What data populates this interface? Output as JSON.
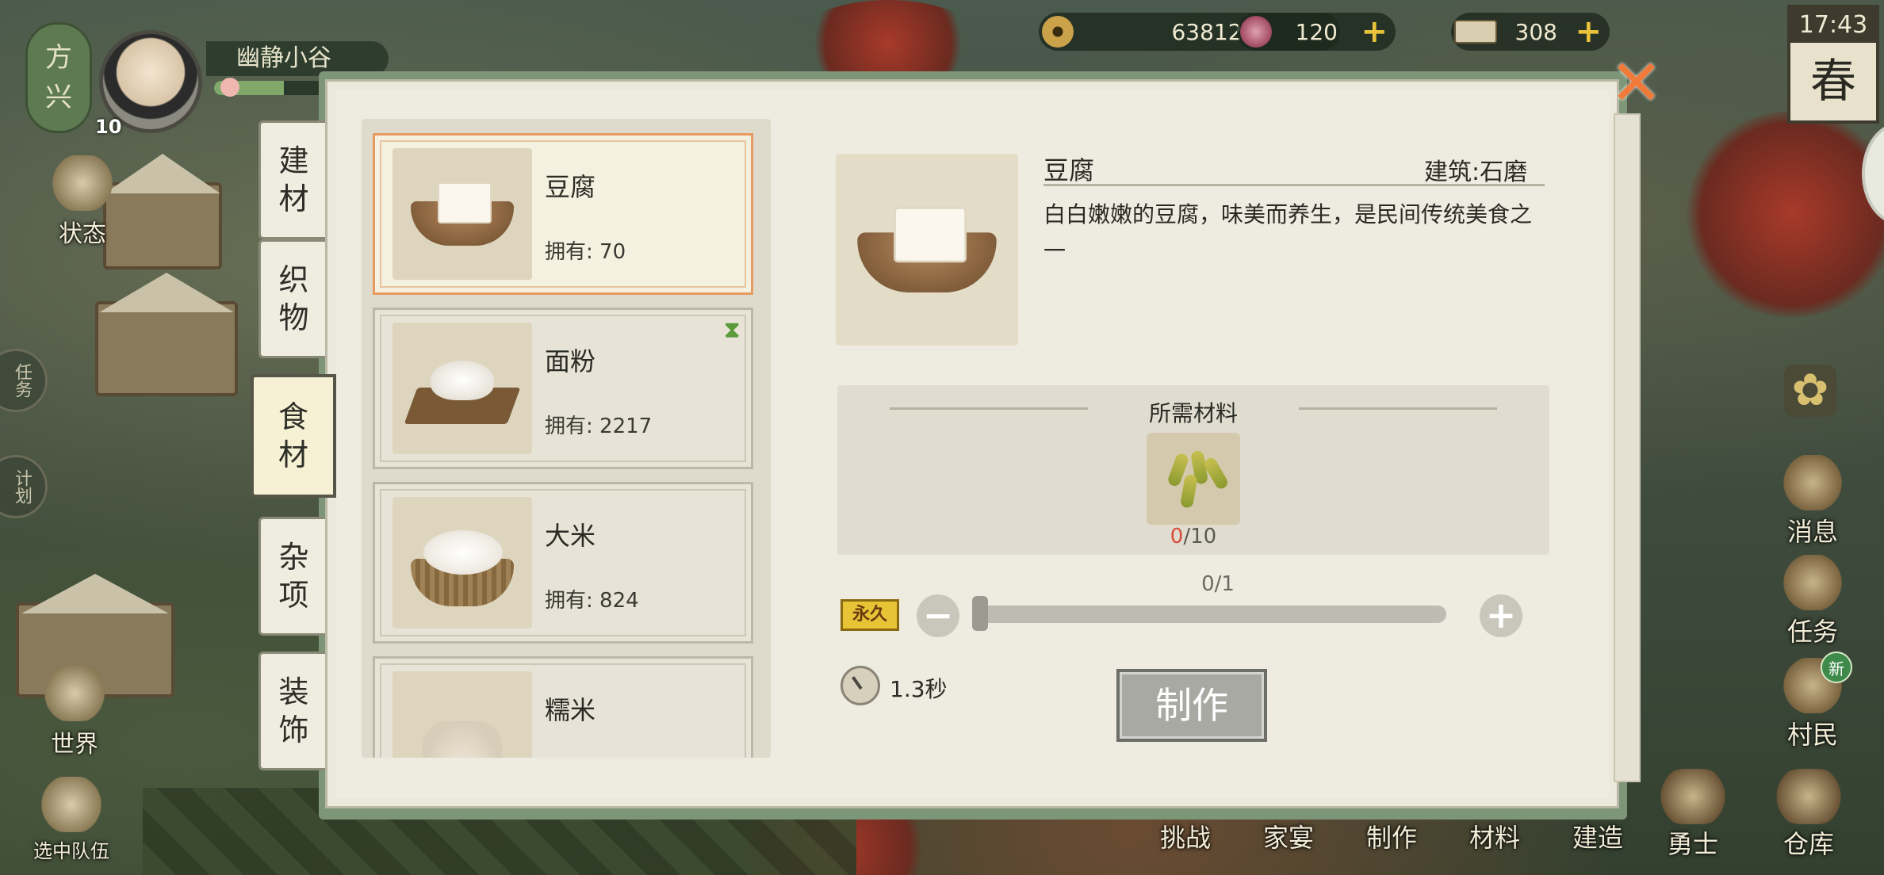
{
  "hud": {
    "region_line1": "方",
    "region_line2": "兴",
    "village_name": "幽静小谷",
    "player_level": "10",
    "exp_fraction": 0.55,
    "coins": "63812",
    "jade": "120",
    "tickets": "308",
    "time": "17:43",
    "season": "春"
  },
  "left_menu": {
    "status": "状态",
    "tasks_round": "任务",
    "plan_round": "计划",
    "world": "世界",
    "team": "选中队伍"
  },
  "right_menu": {
    "messages": "消息",
    "tasks": "任务",
    "villagers": "村民",
    "new_badge": "新",
    "warriors": "勇士",
    "warehouse": "仓库"
  },
  "bottom_nav": [
    "挑战",
    "家宴",
    "制作",
    "材料",
    "建造"
  ],
  "categories": [
    {
      "line1": "建",
      "line2": "材"
    },
    {
      "line1": "织",
      "line2": "物"
    },
    {
      "line1": "食",
      "line2": "材"
    },
    {
      "line1": "杂",
      "line2": "项"
    },
    {
      "line1": "装",
      "line2": "饰"
    }
  ],
  "items": [
    {
      "name": "豆腐",
      "owned": "拥有: 70"
    },
    {
      "name": "面粉",
      "owned": "拥有: 2217"
    },
    {
      "name": "大米",
      "owned": "拥有: 824"
    },
    {
      "name": "糯米",
      "owned": ""
    }
  ],
  "detail": {
    "name": "豆腐",
    "building": "建筑:石磨",
    "description": "白白嫩嫩的豆腐，味美而养生，是民间传统美食之一",
    "materials_title": "所需材料",
    "material_have": "0",
    "material_need": "/10",
    "forever_badge": "永久",
    "quantity": "0/1",
    "duration": "1.3秒",
    "craft_label": "制作"
  },
  "colors": {
    "panel": "#eeebe0",
    "selected_border": "#e89a60",
    "close": "#f07a3a",
    "insufficient": "#d84a3a"
  }
}
